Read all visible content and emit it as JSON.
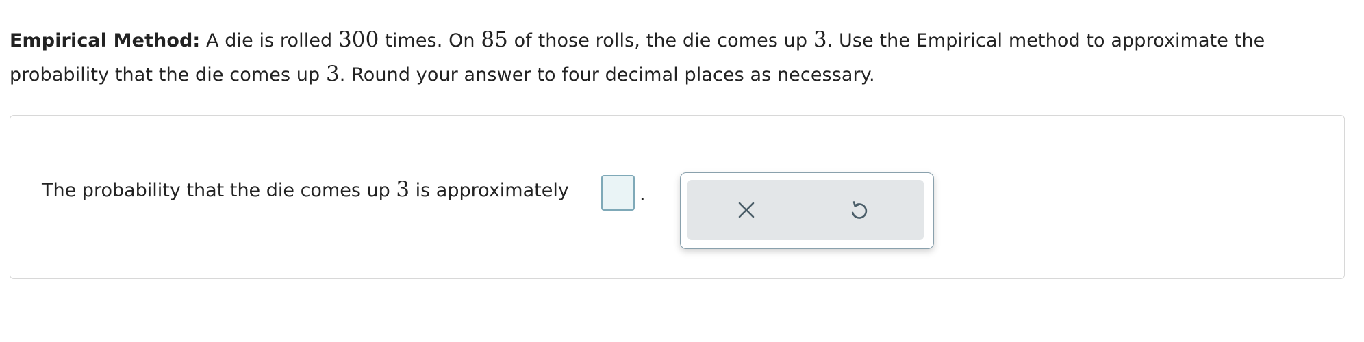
{
  "prompt": {
    "label": "Empirical Method:",
    "seg1": " A die is rolled ",
    "rolls": "300",
    "seg2": " times. On ",
    "hits": "85",
    "seg3": " of those rolls, the die comes up ",
    "face": "3",
    "seg4": ". Use the Empirical method to approximate the probability that the die comes up ",
    "face_again": "3",
    "seg5": ". Round your answer to four decimal places as necessary."
  },
  "answer": {
    "text_before": "The probability that the die comes up ",
    "face": "3",
    "text_after": " is approximately",
    "input_value": "",
    "period": "."
  },
  "toolbar": {
    "clear_icon": "close-icon",
    "undo_icon": "undo-icon"
  },
  "colors": {
    "input_fill": "#eaf4f6",
    "input_border": "#7fa9b8",
    "toolbar_bg": "#e3e6e8",
    "icon_color": "#4a5d68"
  }
}
